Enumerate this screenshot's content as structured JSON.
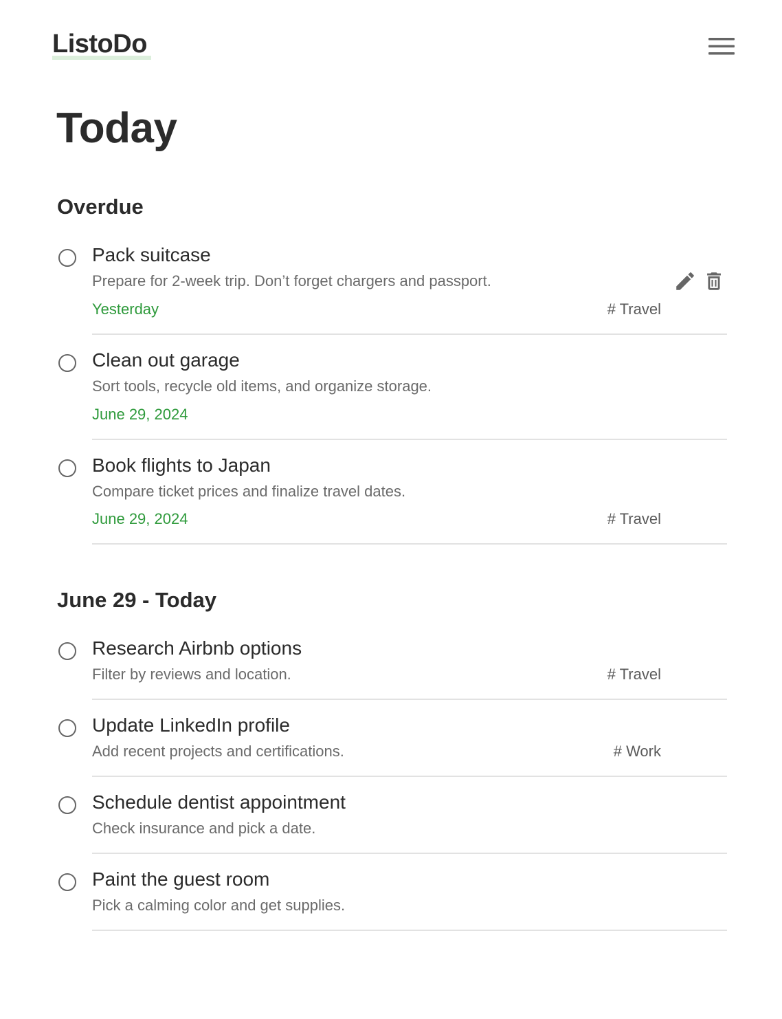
{
  "app": {
    "name": "ListoDo"
  },
  "header": {
    "menu_icon": "hamburger-menu-icon"
  },
  "page": {
    "title": "Today"
  },
  "sections": [
    {
      "title": "Overdue",
      "tasks": [
        {
          "title": "Pack suitcase",
          "description": "Prepare for 2-week trip. Don’t forget chargers and passport.",
          "due": "Yesterday",
          "tag": "# Travel",
          "actions": [
            "edit-icon",
            "delete-icon"
          ]
        },
        {
          "title": "Clean out garage",
          "description": "Sort tools, recycle old items, and organize storage.",
          "due": "June 29, 2024",
          "tag": ""
        },
        {
          "title": "Book flights to Japan",
          "description": "Compare ticket prices and finalize travel dates.",
          "due": "June 29, 2024",
          "tag": "# Travel"
        }
      ]
    },
    {
      "title": "June 29 - Today",
      "tasks": [
        {
          "title": "Research Airbnb options",
          "description": "Filter by reviews and location.",
          "due": "",
          "tag": "# Travel"
        },
        {
          "title": "Update LinkedIn profile",
          "description": "Add recent projects and certifications.",
          "due": "",
          "tag": "# Work"
        },
        {
          "title": "Schedule dentist appointment",
          "description": "Check insurance and pick a date.",
          "due": "",
          "tag": ""
        },
        {
          "title": "Paint the guest room",
          "description": "Pick a calming color and get supplies.",
          "due": "",
          "tag": ""
        }
      ]
    }
  ],
  "colors": {
    "due_date": "#2e9a3b",
    "logo_underline": "#dcefdc",
    "text_primary": "#2b2b2b",
    "text_secondary": "#6a6a6a"
  }
}
